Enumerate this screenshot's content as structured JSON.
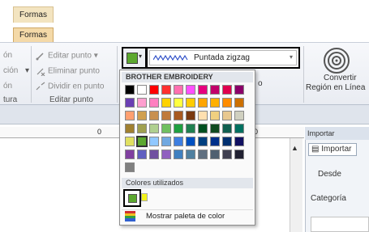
{
  "tabs": {
    "top": "Formas",
    "ribbon": "Formas"
  },
  "ribbon": {
    "left_items": [
      "ón",
      "ción",
      "ón"
    ],
    "left_group_label": "tura",
    "edit_items": [
      "Editar punto",
      "Eliminar punto",
      "Dividir en punto"
    ],
    "edit_group_label": "Editar punto",
    "stitch": "Puntada zigzag",
    "mid_text": "o",
    "convert": [
      "Convertir",
      "Región en Línea"
    ]
  },
  "ruler": {
    "mark1": "0",
    "mark2": "0"
  },
  "import_panel": {
    "header": "Importar",
    "tab": "Importar",
    "desde": "Desde",
    "categoria": "Categoría"
  },
  "palette": {
    "header": "BROTHER EMBROIDERY",
    "used_header": "Colores utilizados",
    "show_palette": "Mostrar paleta de color",
    "colors": [
      "#000000",
      "#ffffff",
      "#ff0000",
      "#ff3030",
      "#ff6fb0",
      "#ff50ff",
      "#e6007e",
      "#c1006a",
      "#e0004e",
      "#8b0069",
      "#6a3fb3",
      "#ff9fcf",
      "#ff80c0",
      "#ffd200",
      "#ffff40",
      "#ffcc00",
      "#ffa500",
      "#ffb000",
      "#ff8c00",
      "#cc7000",
      "#ffa070",
      "#d0a050",
      "#c89050",
      "#c07a3a",
      "#a85a20",
      "#7a3a10",
      "#ffe0b0",
      "#f0d080",
      "#e8c890",
      "#d0d0c0",
      "#a08030",
      "#a0a050",
      "#b0d090",
      "#70c060",
      "#20a040",
      "#208050",
      "#005020",
      "#104a20",
      "#106050",
      "#007060",
      "#e0e060",
      "#5ca82f",
      "#90c8ff",
      "#70a8e0",
      "#3f7fe0",
      "#0050c0",
      "#004080",
      "#00308a",
      "#003070",
      "#101060",
      "#8040a0",
      "#6060c0",
      "#7050a0",
      "#9060c0",
      "#4080c0",
      "#5080a0",
      "#607080",
      "#506070",
      "#404050",
      "#202030",
      "#808080"
    ],
    "selected_index": 41,
    "used_colors": [
      "#5ca82f",
      "#f2f21a"
    ]
  }
}
